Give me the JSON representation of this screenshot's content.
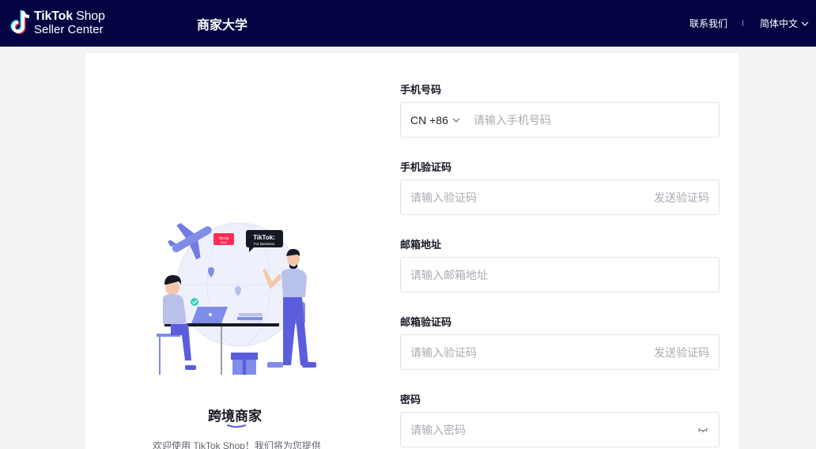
{
  "header": {
    "logo": {
      "line1_bold": "TikTok",
      "line1_light": " Shop",
      "line2": "Seller Center"
    },
    "title": "商家大学",
    "contact": "联系我们",
    "language": "简体中文"
  },
  "hero": {
    "badge_shop": "TikTok Shop",
    "badge_business": "TikTok: For Business",
    "title": "跨境商家",
    "description": "欢迎使用 TikTok Shop！我们将为您提供"
  },
  "form": {
    "phone": {
      "label": "手机号码",
      "country_code": "CN +86",
      "placeholder": "请输入手机号码"
    },
    "phone_code": {
      "label": "手机验证码",
      "placeholder": "请输入验证码",
      "send_label": "发送验证码"
    },
    "email": {
      "label": "邮箱地址",
      "placeholder": "请输入邮箱地址"
    },
    "email_code": {
      "label": "邮箱验证码",
      "placeholder": "请输入验证码",
      "send_label": "发送验证码"
    },
    "password": {
      "label": "密码",
      "placeholder": "请输入密码"
    }
  },
  "colors": {
    "header_bg": "#040442",
    "accent": "#5a5ddc",
    "tiktok_red": "#fe2c55",
    "tiktok_cyan": "#25f4ee"
  }
}
